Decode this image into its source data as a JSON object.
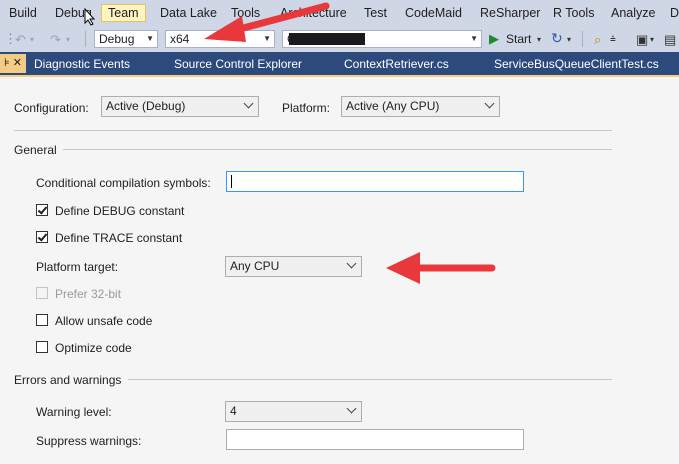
{
  "menu": {
    "items": [
      "Build",
      "Debug",
      "Team",
      "Data Lake",
      "Tools",
      "Architecture",
      "Test",
      "CodeMaid",
      "ReSharper",
      "R Tools",
      "Analyze",
      "D"
    ]
  },
  "toolbar": {
    "config_value": "Debug",
    "platform_value": "x64",
    "startup_value": "C",
    "start_label": "Start"
  },
  "tabs": [
    "Diagnostic Events",
    "Source Control Explorer",
    "ContextRetriever.cs",
    "ServiceBusQueueClientTest.cs"
  ],
  "top": {
    "configuration_label": "Configuration:",
    "configuration_value": "Active (Debug)",
    "platform_label": "Platform:",
    "platform_value": "Active (Any CPU)"
  },
  "general": {
    "title": "General",
    "conditional_label": "Conditional compilation symbols:",
    "conditional_value": "",
    "define_debug": "Define DEBUG constant",
    "define_trace": "Define TRACE constant",
    "platform_target_label": "Platform target:",
    "platform_target_value": "Any CPU",
    "prefer32": "Prefer 32-bit",
    "allow_unsafe": "Allow unsafe code",
    "optimize": "Optimize code"
  },
  "errors": {
    "title": "Errors and warnings",
    "warning_level_label": "Warning level:",
    "warning_level_value": "4",
    "suppress_label": "Suppress warnings:",
    "suppress_value": ""
  }
}
